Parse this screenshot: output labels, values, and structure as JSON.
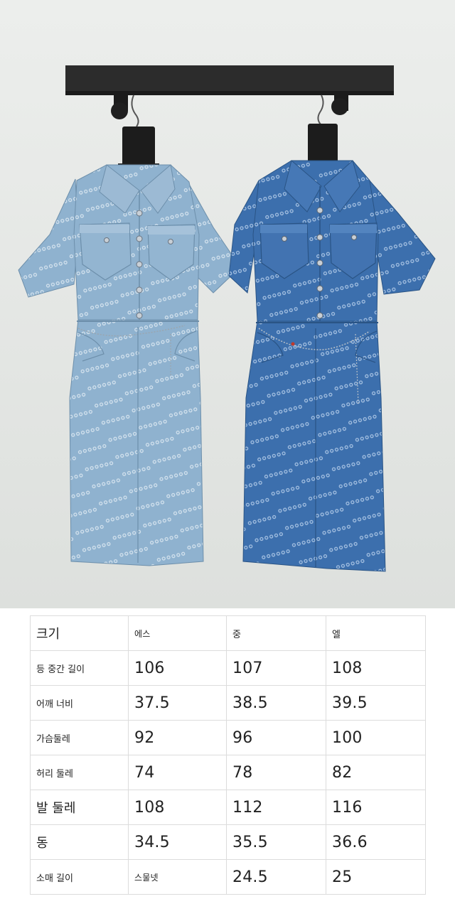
{
  "colors": {
    "wall": "#e6e8e5",
    "rack": "#2c2c2c",
    "dress_light": "#8fb2cf",
    "dress_dark": "#3c6fad",
    "table_border": "#dcdcdc"
  },
  "photo": {
    "subject": "two-denim-shirt-dresses-on-rack",
    "icon": "product-photo"
  },
  "size_table": {
    "header": {
      "label": "크기",
      "s": "에스",
      "m": "중",
      "l": "엘"
    },
    "rows": [
      {
        "label": "등 중간 길이",
        "s": "106",
        "m": "107",
        "l": "108"
      },
      {
        "label": "어깨 너비",
        "s": "37.5",
        "m": "38.5",
        "l": "39.5"
      },
      {
        "label": "가슴둘레",
        "s": "92",
        "m": "96",
        "l": "100"
      },
      {
        "label": "허리 둘레",
        "s": "74",
        "m": "78",
        "l": "82"
      },
      {
        "label": "발 둘레",
        "s": "108",
        "m": "112",
        "l": "116"
      },
      {
        "label": "동",
        "s": "34.5",
        "m": "35.5",
        "l": "36.6"
      },
      {
        "label": "소매 길이",
        "s": "스물넷",
        "m": "24.5",
        "l": "25"
      }
    ]
  }
}
